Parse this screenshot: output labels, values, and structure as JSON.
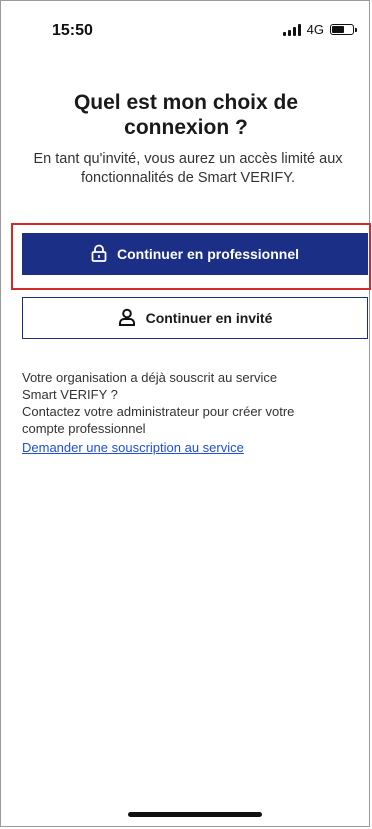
{
  "status_bar": {
    "time": "15:50",
    "network": "4G",
    "icons": [
      "signal-bars-icon",
      "battery-icon"
    ]
  },
  "header": {
    "title_line1": "Quel est mon choix de",
    "title_line2": "connexion ?",
    "subtitle_line1": "En tant qu'invité, vous aurez un accès limité aux",
    "subtitle_line2": "fonctionnalités de Smart VERIFY."
  },
  "buttons": {
    "professional_label": "Continuer en professionnel",
    "professional_icon": "lock-icon",
    "guest_label": "Continuer en invité",
    "guest_icon": "user-icon"
  },
  "info": {
    "line1": "Votre organisation a déjà souscrit au service",
    "line2": "Smart VERIFY ?",
    "line3": "Contactez votre administrateur pour créer votre",
    "line4": "compte professionnel",
    "link_label": "Demander une souscription au service"
  },
  "colors": {
    "primary": "#1c2f86",
    "highlight": "#d12a2a",
    "link": "#1f4fd8"
  }
}
